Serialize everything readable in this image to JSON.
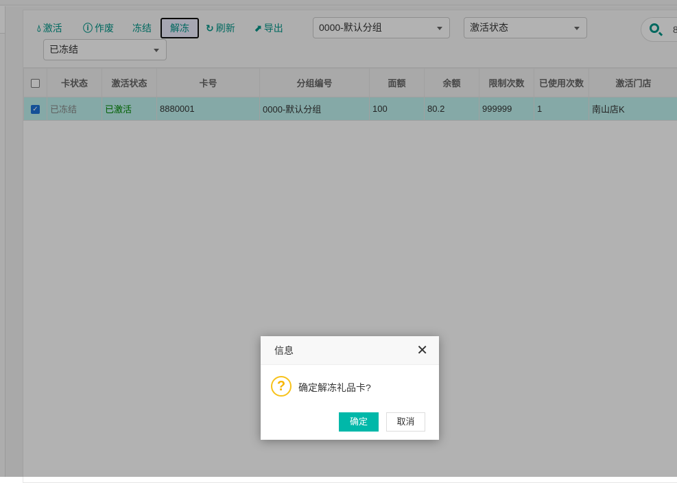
{
  "toolbar": {
    "activate": "激活",
    "void": "作废",
    "freeze": "冻结",
    "unfreeze": "解冻",
    "refresh": "刷新",
    "export": "导出"
  },
  "filters": {
    "group": "0000-默认分组",
    "activation_status": "激活状态",
    "card_status": "已冻结",
    "search_value": "8"
  },
  "table": {
    "headers": [
      "卡状态",
      "激活状态",
      "卡号",
      "分组编号",
      "面额",
      "余额",
      "限制次数",
      "已使用次数",
      "激活门店"
    ],
    "rows": [
      {
        "selected": true,
        "cells": [
          "已冻结",
          "已激活",
          "8880001",
          "0000-默认分组",
          "100",
          "80.2",
          "999999",
          "1",
          "南山店K"
        ]
      }
    ]
  },
  "dialog": {
    "title": "信息",
    "message": "确定解冻礼品卡?",
    "confirm": "确定",
    "cancel": "取消"
  }
}
